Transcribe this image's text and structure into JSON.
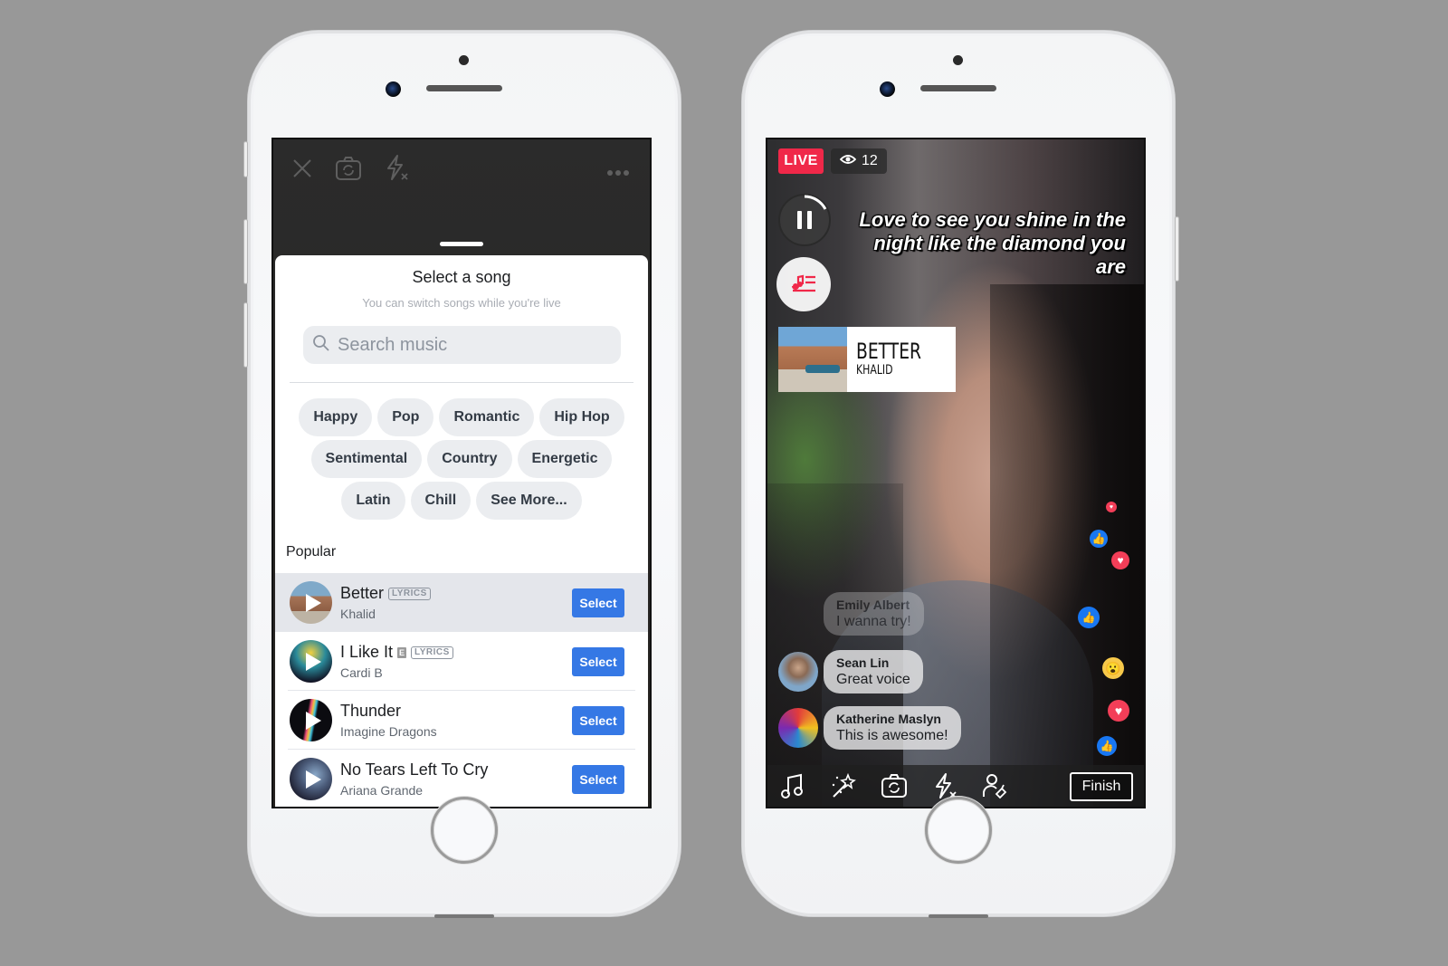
{
  "left_phone": {
    "camera_controls": {
      "close_icon": "close-icon",
      "flip_camera_icon": "camera-flip-icon",
      "flash_off_icon": "flash-off-icon",
      "more_icon": "more-icon"
    },
    "sheet": {
      "title": "Select a song",
      "subtitle": "You can switch songs while you're live",
      "search_placeholder": "Search music",
      "genres": [
        [
          "Happy",
          "Pop",
          "Romantic",
          "Hip Hop"
        ],
        [
          "Sentimental",
          "Country",
          "Energetic"
        ],
        [
          "Latin",
          "Chill",
          "See More..."
        ]
      ],
      "section_label": "Popular",
      "songs": [
        {
          "title": "Better",
          "artist": "Khalid",
          "explicit": false,
          "lyrics_badge": "LYRICS",
          "button": "Select",
          "highlighted": true
        },
        {
          "title": "I Like It",
          "artist": "Cardi B",
          "explicit": true,
          "explicit_badge": "E",
          "lyrics_badge": "LYRICS",
          "button": "Select",
          "highlighted": false
        },
        {
          "title": "Thunder",
          "artist": "Imagine Dragons",
          "explicit": false,
          "button": "Select",
          "highlighted": false
        },
        {
          "title": "No Tears Left To Cry",
          "artist": "Ariana Grande",
          "explicit": false,
          "button": "Select",
          "highlighted": false
        }
      ]
    }
  },
  "right_phone": {
    "live_label": "LIVE",
    "viewer_count": "12",
    "lyrics": "Love to see you shine in the night like the diamond you are",
    "now_playing": {
      "title": "BETTER",
      "artist": "KHALID"
    },
    "comments": [
      {
        "name": "Emily Albert",
        "message": "I wanna try!",
        "faded": true
      },
      {
        "name": "Sean Lin",
        "message": "Great voice",
        "faded": false
      },
      {
        "name": "Katherine Maslyn",
        "message": "This is awesome!",
        "faded": false
      }
    ],
    "reactions": [
      "love",
      "like",
      "love",
      "like",
      "wow",
      "love",
      "like"
    ],
    "bottom_bar": {
      "icons": [
        "music-icon",
        "magic-wand-icon",
        "camera-flip-icon",
        "flash-off-icon",
        "invite-guest-icon"
      ],
      "finish_label": "Finish"
    }
  },
  "colors": {
    "background": "#989898",
    "select_button": "#3578e5",
    "live_red": "#f02849",
    "like_blue": "#1877f2",
    "love_red": "#f33e58",
    "music_accent": "#f02849"
  }
}
